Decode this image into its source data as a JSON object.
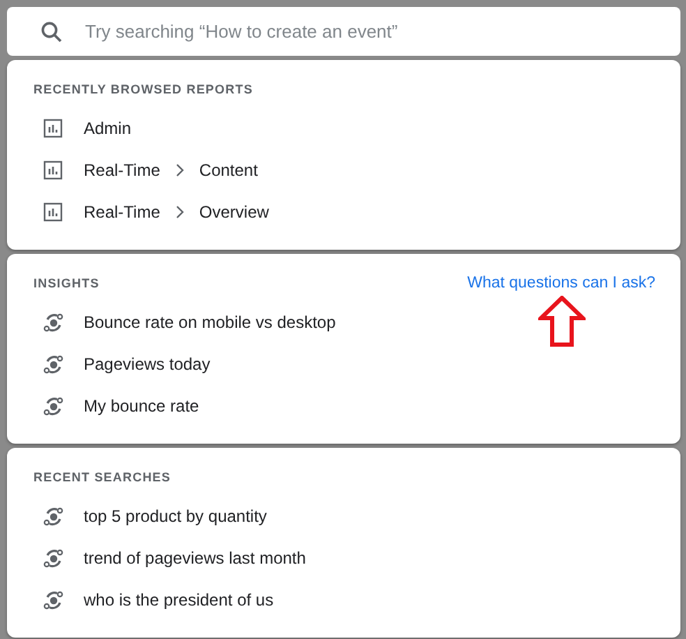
{
  "search": {
    "placeholder": "Try searching “How to create an event”"
  },
  "sections": [
    {
      "title": "RECENTLY BROWSED REPORTS",
      "items": [
        {
          "kind": "report",
          "path": [
            "Admin"
          ]
        },
        {
          "kind": "report",
          "path": [
            "Real-Time",
            "Content"
          ]
        },
        {
          "kind": "report",
          "path": [
            "Real-Time",
            "Overview"
          ]
        }
      ]
    },
    {
      "title": "INSIGHTS",
      "link": "What questions can I ask?",
      "items": [
        {
          "kind": "insight",
          "path": [
            "Bounce rate on mobile vs desktop"
          ]
        },
        {
          "kind": "insight",
          "path": [
            "Pageviews today"
          ]
        },
        {
          "kind": "insight",
          "path": [
            "My bounce rate"
          ]
        }
      ]
    },
    {
      "title": "RECENT SEARCHES",
      "items": [
        {
          "kind": "insight",
          "path": [
            "top 5 product by quantity"
          ]
        },
        {
          "kind": "insight",
          "path": [
            "trend of pageviews last month"
          ]
        },
        {
          "kind": "insight",
          "path": [
            "who is the president of us"
          ]
        }
      ]
    }
  ]
}
